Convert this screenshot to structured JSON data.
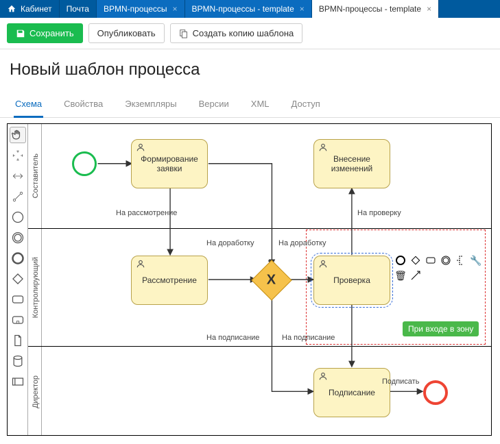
{
  "top_tabs": {
    "items": [
      {
        "label": "Кабинет",
        "icon": "home"
      },
      {
        "label": "Почта"
      },
      {
        "label": "BPMN-процессы",
        "closable": true
      },
      {
        "label": "BPMN-процессы - template",
        "closable": true
      },
      {
        "label": "BPMN-процессы - template",
        "closable": true,
        "active": true
      }
    ]
  },
  "toolbar": {
    "save": "Сохранить",
    "publish": "Опубликовать",
    "copy": "Создать копию шаблона"
  },
  "page_title": "Новый шаблон процесса",
  "sub_tabs": {
    "items": [
      "Схема",
      "Свойства",
      "Экземпляры",
      "Версии",
      "XML",
      "Доступ"
    ],
    "active_index": 0
  },
  "lanes": {
    "a": "Составитель",
    "b": "Контролирующий",
    "c": "Директор"
  },
  "tasks": {
    "form": "Формирование\nзаявки",
    "changes": "Внесение\nизменений",
    "review": "Рассмотрение",
    "check": "Проверка",
    "sign": "Подписание"
  },
  "edge_labels": {
    "to_review": "На рассмотрение",
    "to_rework1": "На доработку",
    "to_rework2": "На доработку",
    "to_check": "На проверку",
    "to_sign1": "На подписание",
    "to_sign2": "На подписание",
    "sign_action": "Подписать"
  },
  "badge": "При входе в зону",
  "gateway_mark": "X"
}
